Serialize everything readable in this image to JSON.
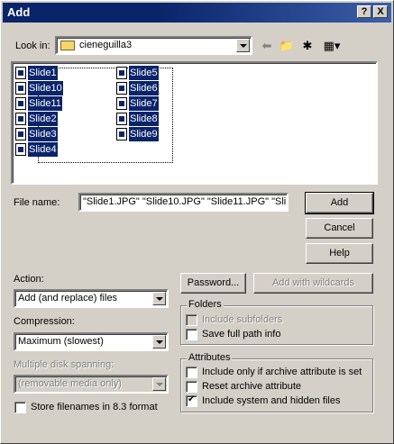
{
  "window": {
    "title": "Add",
    "help_button": "?",
    "close_button": "X"
  },
  "look_in": {
    "label": "Look in:",
    "value": "cieneguilla3"
  },
  "toolbar": {
    "back_icon": "back-arrow-icon",
    "up_icon": "up-folder-icon",
    "new_folder_icon": "new-folder-icon",
    "view_icon": "view-menu-icon"
  },
  "files": [
    "Slide1",
    "Slide10",
    "Slide11",
    "Slide2",
    "Slide3",
    "Slide4",
    "Slide5",
    "Slide6",
    "Slide7",
    "Slide8",
    "Slide9"
  ],
  "filename": {
    "label": "File name:",
    "value": "\"Slide1.JPG\" \"Slide10.JPG\" \"Slide11.JPG\" \"Sli"
  },
  "buttons": {
    "add": "Add",
    "cancel": "Cancel",
    "help": "Help",
    "password": "Password...",
    "add_wildcards": "Add with wildcards"
  },
  "action": {
    "label": "Action:",
    "value": "Add (and replace) files"
  },
  "compression": {
    "label": "Compression:",
    "value": "Maximum (slowest)"
  },
  "spanning": {
    "label": "Multiple disk spanning:",
    "value": "(removable media only)"
  },
  "store_83": {
    "label": "Store filenames in 8.3 format",
    "checked": false
  },
  "folders": {
    "title": "Folders",
    "include_subfolders": "Include subfolders",
    "save_full_path": "Save full path info"
  },
  "attributes": {
    "title": "Attributes",
    "archive_only": "Include only if archive attribute is set",
    "reset_archive": "Reset archive attribute",
    "system_hidden": "Include system and hidden files",
    "system_hidden_checked": true
  }
}
